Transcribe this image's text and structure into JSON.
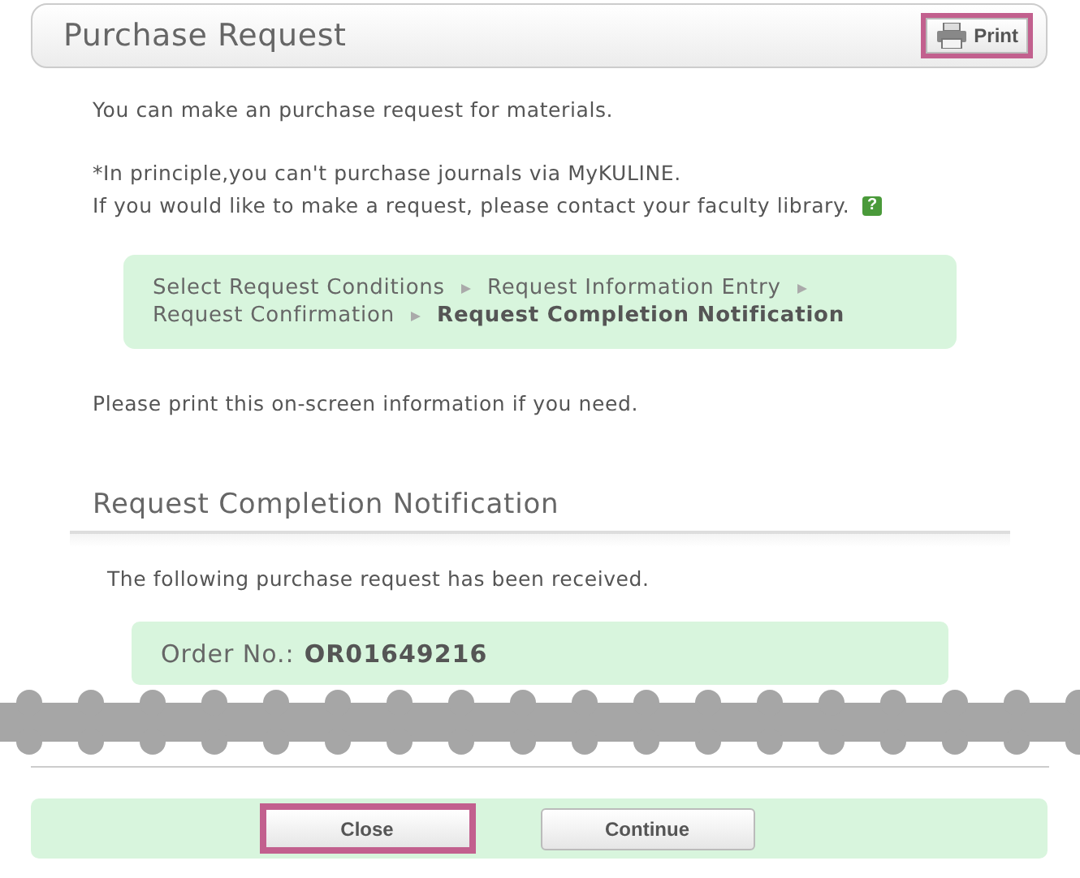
{
  "header": {
    "title": "Purchase Request",
    "print_button": {
      "label": "Print",
      "highlighted": true
    }
  },
  "intro": [
    "You can make an purchase request for materials.",
    "*In principle,you can't purchase journals via MyKULINE.",
    "If you would like to make a request, please contact your faculty library."
  ],
  "help_badge": "?",
  "steps": [
    {
      "label": "Select Request Conditions",
      "selected": false
    },
    {
      "label": "Request Information Entry",
      "selected": false
    },
    {
      "label": "Request Confirmation",
      "selected": false
    },
    {
      "label": "Request Completion Notification",
      "selected": true
    }
  ],
  "print_note": "Please print this on-screen information if you need.",
  "section": {
    "title": "Request Completion Notification",
    "message": "The following purchase request has been received.",
    "order_label": "Order No.:",
    "order_number": "OR01649216"
  },
  "buttons": [
    {
      "label": "Close",
      "highlighted": true
    },
    {
      "label": "Continue",
      "highlighted": false
    }
  ]
}
